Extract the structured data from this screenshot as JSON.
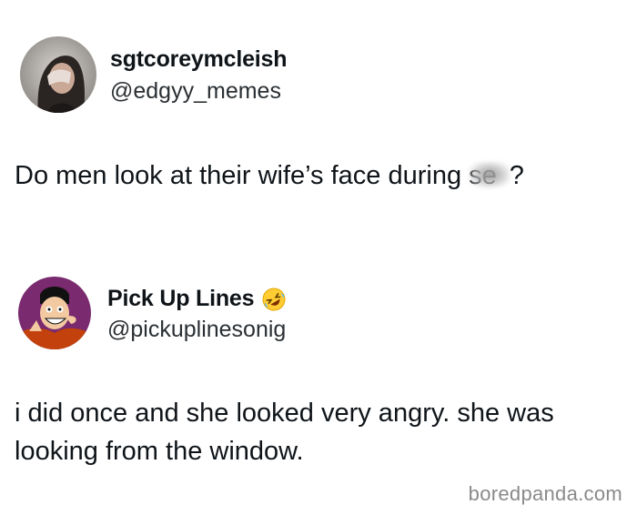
{
  "posts": [
    {
      "display_name": "sgtcoreymcleish",
      "handle": "@edgyy_memes",
      "body": "Do men look at their wife’s face during se",
      "body_tail": "?"
    },
    {
      "display_name": "Pick Up Lines",
      "name_emoji": "rolling-on-floor-laughing-icon",
      "handle": "@pickuplinesonig",
      "body": "i did once and she looked very angry. she was looking from the window."
    }
  ],
  "watermark": "boredpanda.com",
  "colors": {
    "text": "#0f1419",
    "watermark": "#8a8a8a",
    "avatar2_bg": "#7a2a6e"
  }
}
